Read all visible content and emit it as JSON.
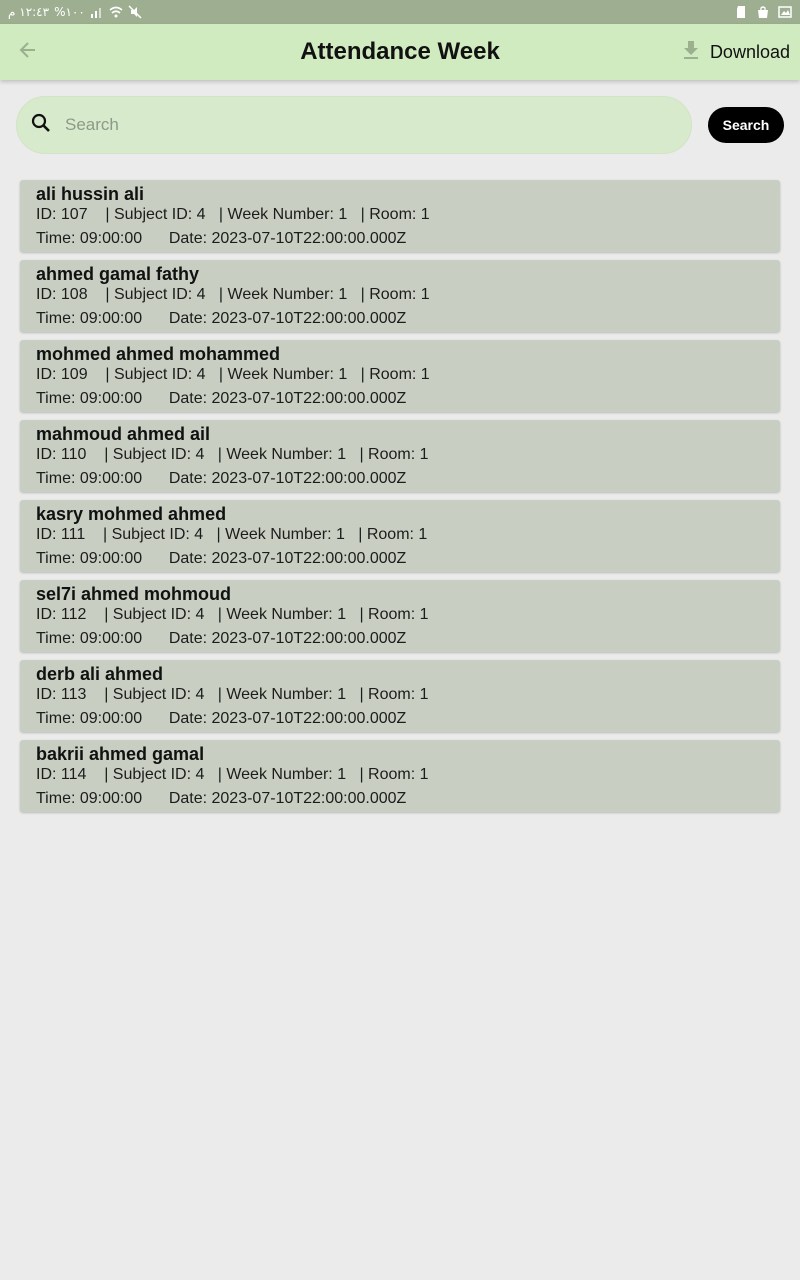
{
  "status_bar": {
    "time": "١٢:٤٣ م",
    "battery": "%١٠٠"
  },
  "header": {
    "title": "Attendance Week",
    "download_label": "Download"
  },
  "search": {
    "placeholder": "Search",
    "value": "",
    "button_label": "Search"
  },
  "colors": {
    "app_bar": "#d0ebc0",
    "search_field": "#d8eacc",
    "card": "#c8cfc2",
    "background": "#ebebeb"
  },
  "records": [
    {
      "name": "ali hussin ali",
      "id": "ID: 107",
      "subject": "| Subject ID: 4",
      "week": "| Week Number: 1",
      "room": "| Room: 1",
      "time": "Time: 09:00:00",
      "date": "Date: 2023-07-10T22:00:00.000Z"
    },
    {
      "name": "ahmed gamal fathy",
      "id": "ID: 108",
      "subject": "| Subject ID: 4",
      "week": "| Week Number: 1",
      "room": "| Room: 1",
      "time": "Time: 09:00:00",
      "date": "Date: 2023-07-10T22:00:00.000Z"
    },
    {
      "name": "mohmed ahmed mohammed",
      "id": "ID: 109",
      "subject": "| Subject ID: 4",
      "week": "| Week Number: 1",
      "room": "| Room: 1",
      "time": "Time: 09:00:00",
      "date": "Date: 2023-07-10T22:00:00.000Z"
    },
    {
      "name": "mahmoud ahmed ail",
      "id": "ID: 110",
      "subject": "| Subject ID: 4",
      "week": "| Week Number: 1",
      "room": "| Room: 1",
      "time": "Time: 09:00:00",
      "date": "Date: 2023-07-10T22:00:00.000Z"
    },
    {
      "name": "kasry mohmed ahmed",
      "id": "ID: 111",
      "subject": "| Subject ID: 4",
      "week": "| Week Number: 1",
      "room": "| Room: 1",
      "time": "Time: 09:00:00",
      "date": "Date: 2023-07-10T22:00:00.000Z"
    },
    {
      "name": "sel7i ahmed mohmoud",
      "id": "ID: 112",
      "subject": "| Subject ID: 4",
      "week": "| Week Number: 1",
      "room": "| Room: 1",
      "time": "Time: 09:00:00",
      "date": "Date: 2023-07-10T22:00:00.000Z"
    },
    {
      "name": "derb ali ahmed",
      "id": "ID: 113",
      "subject": "| Subject ID: 4",
      "week": "| Week Number: 1",
      "room": "| Room: 1",
      "time": "Time: 09:00:00",
      "date": "Date: 2023-07-10T22:00:00.000Z"
    },
    {
      "name": "bakrii ahmed gamal",
      "id": "ID: 114",
      "subject": "| Subject ID: 4",
      "week": "| Week Number: 1",
      "room": "| Room: 1",
      "time": "Time: 09:00:00",
      "date": "Date: 2023-07-10T22:00:00.000Z"
    }
  ]
}
